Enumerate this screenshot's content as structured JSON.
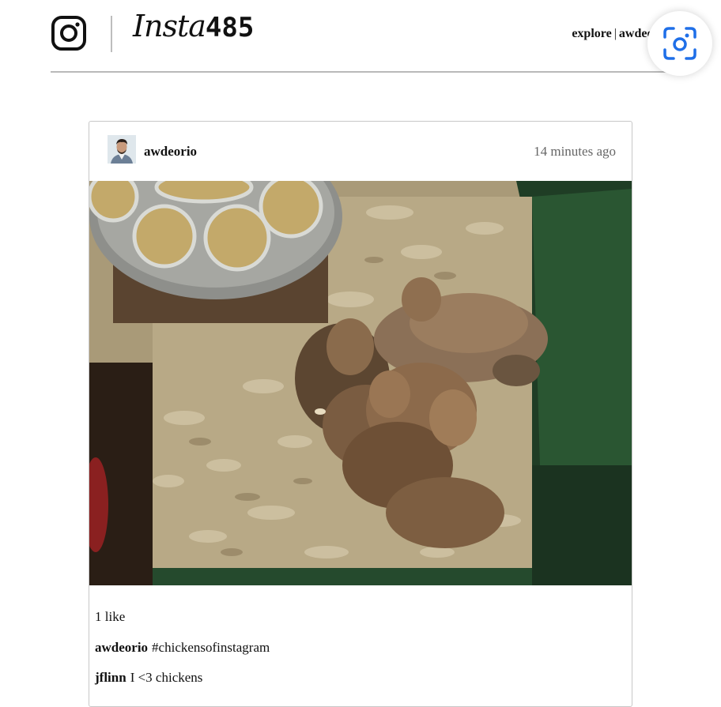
{
  "header": {
    "brand_script": "Insta",
    "brand_number": "485",
    "nav": {
      "explore": "explore",
      "separator": "|",
      "user": "awdeorio"
    }
  },
  "icons": {
    "logo": "instagram-camera-icon",
    "lens": "visual-lookup-icon"
  },
  "post": {
    "owner": "awdeorio",
    "timestamp": "14 minutes ago",
    "photo_alt": "chicks in wood shavings",
    "likes": "1 like",
    "comments": [
      {
        "owner": "awdeorio",
        "text": "#chickensofinstagram"
      },
      {
        "owner": "jflinn",
        "text": "I <3 chickens"
      }
    ]
  },
  "colors": {
    "rule": "#b9b9b9",
    "card_border": "#c8c8c8",
    "lens_blue": "#1f6fe8"
  }
}
